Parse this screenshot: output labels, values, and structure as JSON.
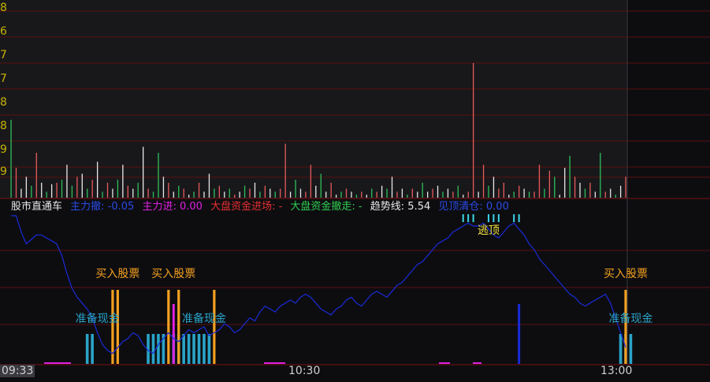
{
  "colors": {
    "background": "#0d0d10",
    "panel_top_bg": "#18181b",
    "grid": "#5a0f0f",
    "axis_frame": "#7a1010",
    "ytick": "#c8b400",
    "vol_up": "#e85a5a",
    "vol_down": "#2fbf5a",
    "vol_flat": "#e8e8e8",
    "trend_line": "#1a2ad8",
    "cash_bar": "#2aa3c8",
    "buy_bar": "#f5a020",
    "magenta": "#e020e0",
    "blue_bar": "#1a2ad8",
    "escape_mark": "#3ad6e8",
    "escape_text": "#f0e040"
  },
  "upper_panel": {
    "ytick_labels": [
      "8",
      "6",
      "7",
      "7",
      "8",
      "8",
      "9",
      "9"
    ]
  },
  "legend": [
    {
      "text": "股市直通车",
      "color": "#e8e8e8"
    },
    {
      "text": "主力撤: -0.05",
      "color": "#2a4ae8"
    },
    {
      "text": "主力进: 0.00",
      "color": "#e020e0"
    },
    {
      "text": "大盘资金进场: -",
      "color": "#e83030"
    },
    {
      "text": "大盘资金撤走: -",
      "color": "#30d050"
    },
    {
      "text": "趋势线: 5.54",
      "color": "#e8e8e8"
    },
    {
      "text": "见顶清仓: 0.00",
      "color": "#2a4ae8"
    }
  ],
  "x_axis": {
    "ticks": [
      {
        "label": "09:33",
        "index": 0
      },
      {
        "label": "10:30",
        "index": 57
      },
      {
        "label": "13:00",
        "index": 120
      }
    ]
  },
  "signals": {
    "buy_label": "买入股票",
    "cash_label": "准备现金",
    "escape_label": "逃顶",
    "buy_marks": [
      {
        "label": "买入股票",
        "index": 21
      },
      {
        "label": "买入股票",
        "index": 32
      },
      {
        "label": "买入股票",
        "index": 121
      }
    ],
    "cash_marks": [
      {
        "label": "准备现金",
        "index": 17
      },
      {
        "label": "准备现金",
        "index": 38
      },
      {
        "label": "准备现金",
        "index": 122
      }
    ],
    "escape_marks": [
      {
        "label": "逃顶",
        "index": 94
      }
    ]
  },
  "chart_data": {
    "type": "bar",
    "note_series": "upper: volume bars; lower: trend line with signal bars",
    "n_points": 122,
    "volume": [
      [
        52,
        "d"
      ],
      [
        20,
        "u"
      ],
      [
        6,
        "f"
      ],
      [
        14,
        "f"
      ],
      [
        8,
        "d"
      ],
      [
        30,
        "u"
      ],
      [
        10,
        "f"
      ],
      [
        4,
        "d"
      ],
      [
        9,
        "f"
      ],
      [
        10,
        "u"
      ],
      [
        12,
        "d"
      ],
      [
        22,
        "f"
      ],
      [
        8,
        "d"
      ],
      [
        14,
        "u"
      ],
      [
        16,
        "f"
      ],
      [
        6,
        "d"
      ],
      [
        12,
        "u"
      ],
      [
        24,
        "f"
      ],
      [
        4,
        "d"
      ],
      [
        10,
        "u"
      ],
      [
        6,
        "f"
      ],
      [
        12,
        "d"
      ],
      [
        22,
        "f"
      ],
      [
        8,
        "u"
      ],
      [
        6,
        "f"
      ],
      [
        10,
        "d"
      ],
      [
        34,
        "f"
      ],
      [
        6,
        "u"
      ],
      [
        4,
        "d"
      ],
      [
        30,
        "d"
      ],
      [
        14,
        "f"
      ],
      [
        10,
        "u"
      ],
      [
        4,
        "f"
      ],
      [
        8,
        "d"
      ],
      [
        6,
        "u"
      ],
      [
        2,
        "f"
      ],
      [
        4,
        "d"
      ],
      [
        10,
        "u"
      ],
      [
        4,
        "f"
      ],
      [
        16,
        "f"
      ],
      [
        6,
        "d"
      ],
      [
        8,
        "u"
      ],
      [
        4,
        "f"
      ],
      [
        6,
        "d"
      ],
      [
        2,
        "u"
      ],
      [
        4,
        "f"
      ],
      [
        8,
        "d"
      ],
      [
        6,
        "u"
      ],
      [
        10,
        "f"
      ],
      [
        4,
        "d"
      ],
      [
        8,
        "u"
      ],
      [
        6,
        "f"
      ],
      [
        4,
        "d"
      ],
      [
        6,
        "u"
      ],
      [
        36,
        "u"
      ],
      [
        4,
        "f"
      ],
      [
        12,
        "d"
      ],
      [
        6,
        "f"
      ],
      [
        4,
        "u"
      ],
      [
        22,
        "u"
      ],
      [
        8,
        "f"
      ],
      [
        16,
        "d"
      ],
      [
        4,
        "f"
      ],
      [
        10,
        "u"
      ],
      [
        2,
        "f"
      ],
      [
        4,
        "d"
      ],
      [
        6,
        "u"
      ],
      [
        4,
        "f"
      ],
      [
        2,
        "d"
      ],
      [
        4,
        "u"
      ],
      [
        2,
        "f"
      ],
      [
        6,
        "d"
      ],
      [
        4,
        "u"
      ],
      [
        8,
        "f"
      ],
      [
        6,
        "d"
      ],
      [
        14,
        "f"
      ],
      [
        4,
        "u"
      ],
      [
        6,
        "f"
      ],
      [
        2,
        "d"
      ],
      [
        6,
        "u"
      ],
      [
        4,
        "f"
      ],
      [
        10,
        "d"
      ],
      [
        4,
        "f"
      ],
      [
        6,
        "u"
      ],
      [
        8,
        "f"
      ],
      [
        4,
        "d"
      ],
      [
        6,
        "f"
      ],
      [
        4,
        "u"
      ],
      [
        8,
        "d"
      ],
      [
        2,
        "f"
      ],
      [
        4,
        "u"
      ],
      [
        90,
        "u"
      ],
      [
        4,
        "f"
      ],
      [
        22,
        "u"
      ],
      [
        8,
        "d"
      ],
      [
        14,
        "f"
      ],
      [
        6,
        "u"
      ],
      [
        10,
        "u"
      ],
      [
        2,
        "f"
      ],
      [
        4,
        "d"
      ],
      [
        8,
        "u"
      ],
      [
        6,
        "f"
      ],
      [
        4,
        "d"
      ],
      [
        4,
        "u"
      ],
      [
        22,
        "u"
      ],
      [
        6,
        "d"
      ],
      [
        18,
        "u"
      ],
      [
        14,
        "d"
      ],
      [
        2,
        "f"
      ],
      [
        20,
        "f"
      ],
      [
        28,
        "d"
      ],
      [
        14,
        "u"
      ],
      [
        10,
        "f"
      ],
      [
        6,
        "d"
      ],
      [
        10,
        "u"
      ],
      [
        4,
        "f"
      ],
      [
        30,
        "d"
      ],
      [
        4,
        "u"
      ],
      [
        6,
        "f"
      ],
      [
        2,
        "d"
      ],
      [
        8,
        "f"
      ],
      [
        14,
        "u"
      ]
    ],
    "trend": [
      99,
      99,
      88,
      80,
      83,
      86,
      86,
      84,
      82,
      80,
      72,
      60,
      50,
      44,
      40,
      36,
      30,
      20,
      12,
      8,
      6,
      10,
      14,
      16,
      20,
      18,
      12,
      8,
      6,
      12,
      16,
      20,
      16,
      14,
      18,
      22,
      20,
      22,
      24,
      18,
      20,
      22,
      26,
      24,
      20,
      22,
      26,
      30,
      28,
      34,
      38,
      36,
      34,
      38,
      40,
      42,
      40,
      44,
      46,
      44,
      40,
      36,
      34,
      32,
      36,
      38,
      42,
      44,
      40,
      38,
      42,
      46,
      48,
      46,
      44,
      48,
      52,
      54,
      58,
      62,
      66,
      68,
      72,
      76,
      80,
      82,
      84,
      88,
      90,
      92,
      94,
      92,
      92,
      94,
      90,
      86,
      84,
      88,
      92,
      94,
      90,
      86,
      80,
      76,
      70,
      66,
      62,
      58,
      54,
      50,
      46,
      44,
      40,
      38,
      40,
      42,
      44,
      46,
      40,
      30,
      20,
      10
    ],
    "bars_cash": [
      15,
      16,
      27,
      28,
      29,
      30,
      32,
      33,
      34,
      35,
      36,
      37,
      38,
      39,
      120,
      121,
      122
    ],
    "bars_buy": [
      20,
      21,
      31,
      33,
      40,
      121
    ],
    "bars_magenta": [
      32
    ],
    "bars_blue": [
      100
    ],
    "escape_marks_idx": [
      89,
      90,
      91,
      94,
      95,
      96,
      99,
      100
    ]
  }
}
